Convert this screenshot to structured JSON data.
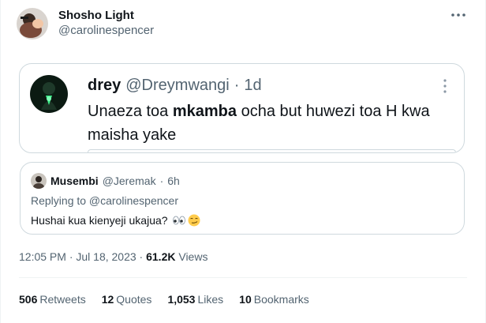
{
  "tweet": {
    "author_name": "Shosho Light",
    "author_handle": "@carolinespencer",
    "more_icon": "more-horizontal-icon",
    "timestamp": "12:05 PM · Jul 18, 2023",
    "separator": "·",
    "views_count": "61.2K",
    "views_label": "Views"
  },
  "quoted": {
    "name": "drey",
    "handle": "@Dreymwangi",
    "time": "1d",
    "text_before": "Unaeza toa ",
    "text_bold": "mkamba",
    "text_after": " ocha but huwezi toa H kwa maisha yake",
    "more_icon": "more-vertical-icon"
  },
  "reply": {
    "name": "Musembi",
    "handle": "@Jeremak",
    "time": "6h",
    "replying_to": "Replying to @carolinespencer",
    "text": "Hushai kua kienyeji ukajua?",
    "emoji_icons": [
      "eyes-icon",
      "smirk-face-icon"
    ]
  },
  "stats": [
    {
      "num": "506",
      "label": "Retweets"
    },
    {
      "num": "12",
      "label": "Quotes"
    },
    {
      "num": "1,053",
      "label": "Likes"
    },
    {
      "num": "10",
      "label": "Bookmarks"
    }
  ],
  "colors": {
    "text": "#0f1419",
    "secondary": "#536471",
    "border": "#cfd9de",
    "divider": "#eff3f4"
  }
}
